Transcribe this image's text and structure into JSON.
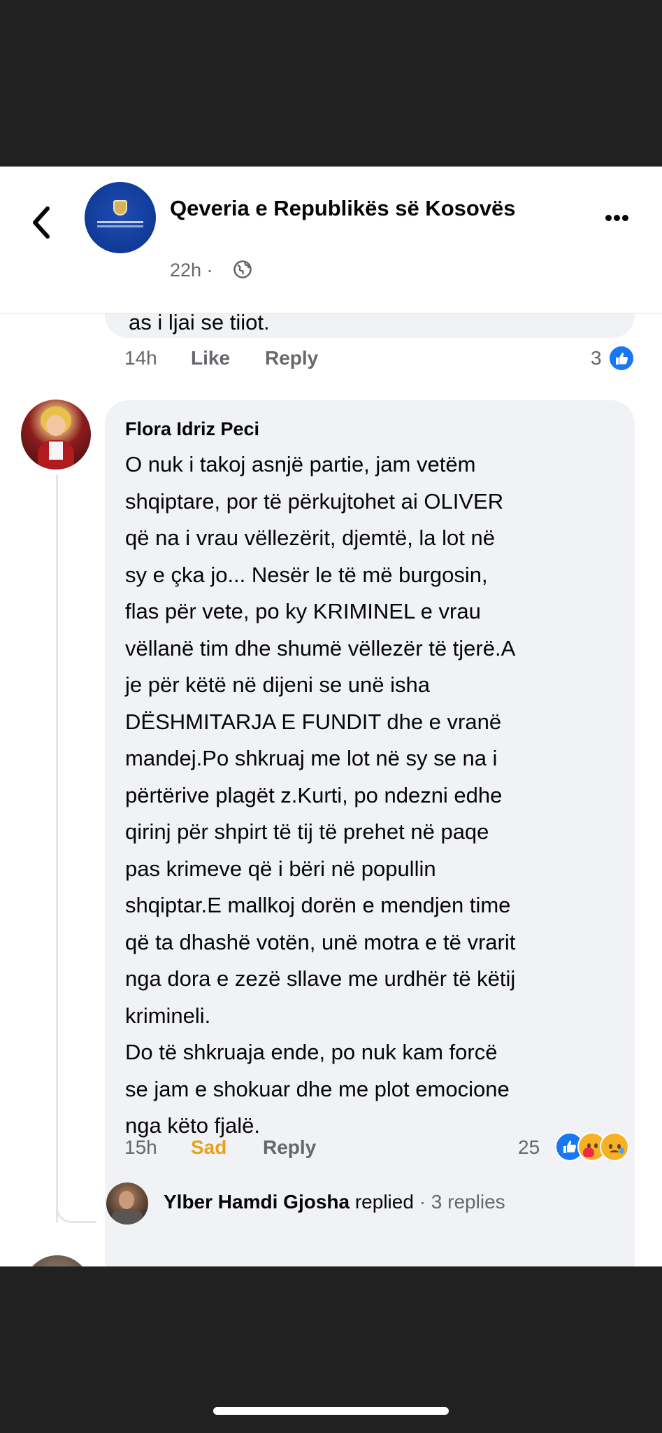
{
  "header": {
    "page_name": "Qeveria e Republikës së Kosovës",
    "post_time": "22h ·",
    "back_icon": "chevron-left-icon",
    "privacy_icon": "globe-icon",
    "more_icon": "more-horizontal-icon"
  },
  "previous_comment": {
    "text_fragment": "as i ljai se tiiot.",
    "time": "14h",
    "like_label": "Like",
    "reply_label": "Reply",
    "reaction_count": "3"
  },
  "comment": {
    "author": "Flora Idriz Peci",
    "text": "O nuk i takoj asnjë partie, jam vetëm\nshqiptare,  por të përkujtohet ai OLIVER\nqë na i vrau vëllezërit, djemtë, la lot në\nsy e çka jo... Nesër le të më burgosin,\nflas për vete, po ky KRIMINEL e vrau\nvëllanë tim dhe shumë vëllezër të tjerë.A\nje për këtë në dijeni se unë isha\nDËSHMITARJA E FUNDIT dhe e vranë\nmandej.Po shkruaj me lot në sy se na i\npërtërive plagët z.Kurti, po ndezni edhe\nqirinj për shpirt të tij të prehet në paqe\npas krimeve që i bëri në popullin\nshqiptar.E mallkoj dorën e mendjen time\nqë ta dhashë votën, unë motra e të vrarit\nnga dora e zezë sllave me urdhër të këtij\nkrimineli.\nDo të shkruaja ende, po nuk kam forcë\nse jam e shokuar dhe me plot emocione\nnga këto fjalë.",
    "time": "15h",
    "reaction_label": "Sad",
    "reply_label": "Reply",
    "reaction_count": "25",
    "reactions": [
      "like-icon",
      "care-icon",
      "sad-icon"
    ]
  },
  "replies": {
    "name": "Ylber Hamdi Gjosha",
    "action": " replied",
    "count_text": " · 3 replies"
  },
  "colors": {
    "bubble": "#f0f2f5",
    "meta_text": "#65676b",
    "like_blue": "#1877f2",
    "sad_yellow": "#e8a11a",
    "frame": "#212122"
  }
}
